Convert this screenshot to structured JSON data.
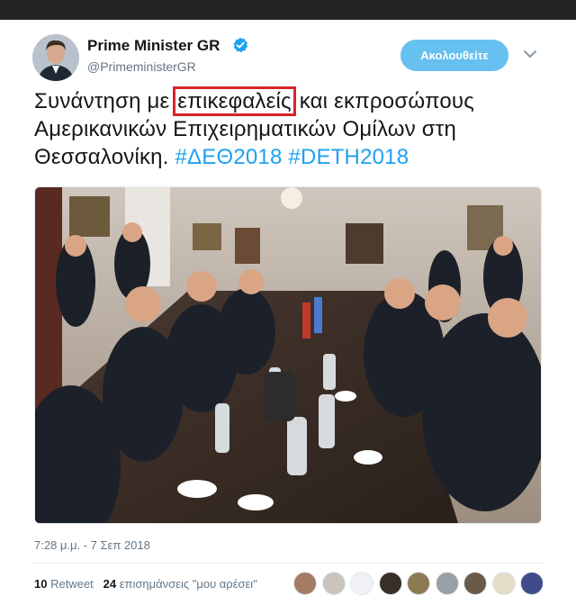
{
  "account": {
    "name": "Prime Minister GR",
    "handle": "@PrimeministerGR",
    "follow_label": "Ακολουθείτε",
    "verified_icon": "verified-badge-icon"
  },
  "tweet": {
    "text_before": "Συνάντηση με ",
    "text_highlight": "επικεφαλείς",
    "text_after": " και εκπροσώπους",
    "line2": "Αμερικανικών Επιχειρηματικών Ομίλων στη",
    "line3": "Θεσσαλονίκη. ",
    "hashtag1": "#ΔΕΘ2018",
    "hashtag2": "#DETH2018",
    "timestamp": "7:28 μ.μ. - 7 Σεπ 2018"
  },
  "stats": {
    "retweet_count": "10",
    "retweet_label": "Retweet",
    "like_count": "24",
    "like_label": "επισημάνσεις \"μου αρέσει\""
  },
  "colors": {
    "link": "#1da1f2",
    "follow_button": "#66c0f0",
    "highlight_box": "#d8232a",
    "meta_text": "#657786"
  }
}
